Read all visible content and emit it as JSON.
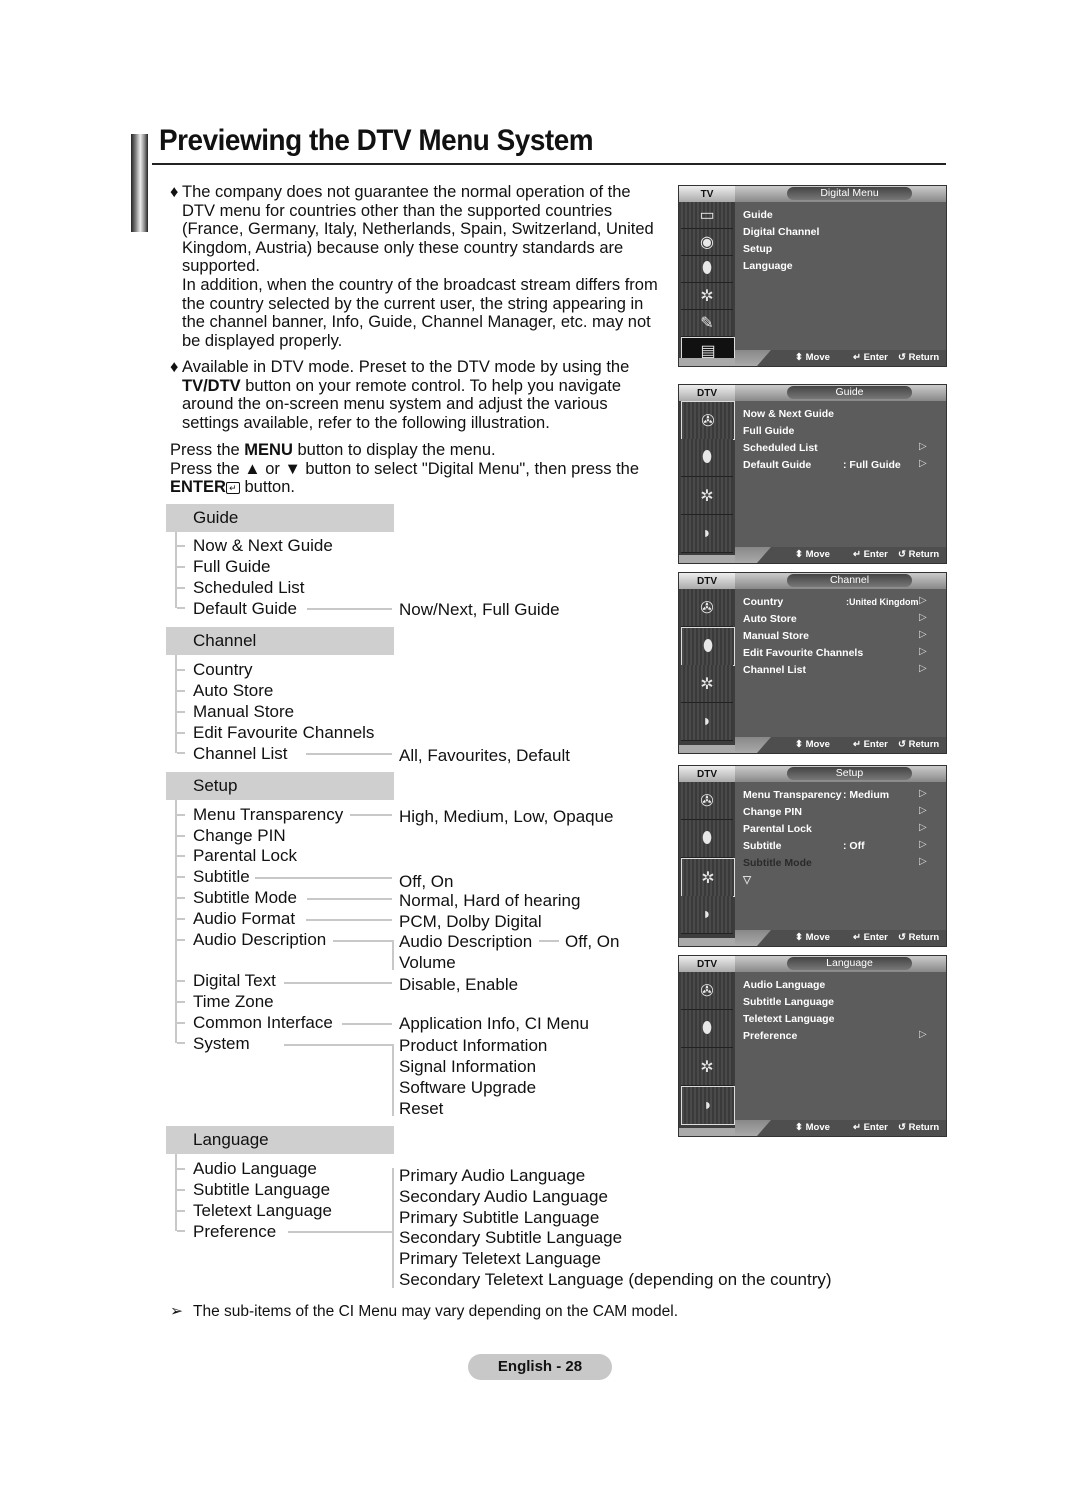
{
  "title": "Previewing the DTV Menu System",
  "bullets": [
    {
      "icon": "♦",
      "lines": [
        "The company does not guarantee the normal operation of the",
        "DTV menu for countries other than the supported countries",
        "(France, Germany, Italy, Netherlands, Spain, Switzerland, United",
        "Kingdom, Austria) because only these country standards are",
        "supported.",
        "In addition, when the country of the broadcast stream differs from",
        "the country selected by the current user, the string appearing in",
        "the channel banner, Info, Guide, Channel Manager, etc. may not",
        "be displayed properly."
      ]
    },
    {
      "icon": "♦",
      "lines_prefix": "Available in DTV mode. Preset to the DTV mode by using the",
      "bold_word": "TV/DTV",
      "line2_rest": " button on your remote control. To help you navigate",
      "line3": "around the on-screen menu system and adjust the various",
      "line4": "settings available, refer to the following illustration."
    }
  ],
  "instructions": {
    "l1_pre": "Press the ",
    "l1_bold": "MENU",
    "l1_post": " button to display the menu.",
    "l2": "Press the ▲ or ▼ button to select \"Digital Menu\", then press the",
    "l3_bold": "ENTER",
    "l3_post": " button."
  },
  "tree": {
    "guide": {
      "heading": "Guide",
      "items": [
        "Now & Next Guide",
        "Full Guide",
        "Scheduled List",
        "Default Guide"
      ],
      "options": {
        "default_guide": "Now/Next, Full Guide"
      }
    },
    "channel": {
      "heading": "Channel",
      "items": [
        "Country",
        "Auto Store",
        "Manual Store",
        "Edit Favourite Channels",
        "Channel List"
      ],
      "options": {
        "channel_list": "All, Favourites, Default"
      }
    },
    "setup": {
      "heading": "Setup",
      "items": [
        "Menu Transparency",
        "Change PIN",
        "Parental Lock",
        "Subtitle",
        "Subtitle Mode",
        "Audio Format",
        "Audio Description",
        "Digital Text",
        "Time Zone",
        "Common Interface",
        "System"
      ],
      "options": {
        "menu_transparency": "High, Medium, Low, Opaque",
        "subtitle": "Off, On",
        "subtitle_mode": "Normal, Hard of hearing",
        "audio_format": "PCM, Dolby Digital",
        "audio_description": [
          "Audio Description",
          "Volume"
        ],
        "audio_description_sub": "Off, On",
        "digital_text": "Disable, Enable",
        "common_interface": "Application Info, CI Menu",
        "system": [
          "Product Information",
          "Signal Information",
          "Software Upgrade",
          "Reset"
        ]
      }
    },
    "language": {
      "heading": "Language",
      "items": [
        "Audio Language",
        "Subtitle Language",
        "Teletext Language",
        "Preference"
      ],
      "options": {
        "preference": [
          "Primary Audio Language",
          "Secondary Audio Language",
          "Primary Subtitle Language",
          "Secondary Subtitle Language",
          "Primary Teletext Language",
          "Secondary Teletext Language (depending on the country)"
        ]
      }
    }
  },
  "panels": [
    {
      "mode": "TV",
      "title": "Digital Menu",
      "items": [
        {
          "label": "Guide"
        },
        {
          "label": "Digital Channel"
        },
        {
          "label": "Setup"
        },
        {
          "label": "Language"
        }
      ]
    },
    {
      "mode": "DTV",
      "title": "Guide",
      "items": [
        {
          "label": "Now & Next Guide"
        },
        {
          "label": "Full Guide"
        },
        {
          "label": "Scheduled List",
          "arrow": true
        },
        {
          "label": "Default Guide",
          "value": ": Full Guide",
          "arrow": true
        }
      ]
    },
    {
      "mode": "DTV",
      "title": "Channel",
      "items": [
        {
          "label": "Country",
          "value": ":United Kingdom",
          "arrow": true
        },
        {
          "label": "Auto Store",
          "arrow": true
        },
        {
          "label": "Manual Store",
          "arrow": true
        },
        {
          "label": "Edit Favourite Channels",
          "arrow": true
        },
        {
          "label": "Channel List",
          "arrow": true
        }
      ]
    },
    {
      "mode": "DTV",
      "title": "Setup",
      "items": [
        {
          "label": "Menu Transparency",
          "value": ": Medium",
          "arrow": true
        },
        {
          "label": "Change PIN",
          "arrow": true
        },
        {
          "label": "Parental Lock",
          "arrow": true
        },
        {
          "label": "Subtitle",
          "value": ": Off",
          "arrow": true
        },
        {
          "label": "Subtitle  Mode",
          "arrow": true,
          "dim": true
        }
      ],
      "more": "▽"
    },
    {
      "mode": "DTV",
      "title": "Language",
      "items": [
        {
          "label": "Audio Language"
        },
        {
          "label": "Subtitle Language"
        },
        {
          "label": "Teletext Language"
        },
        {
          "label": "Preference",
          "arrow": true
        }
      ]
    }
  ],
  "panel_footer": {
    "move": "Move",
    "enter": "Enter",
    "return": "Return"
  },
  "note": {
    "icon": "➢",
    "text": "The sub-items of the CI Menu may vary depending on the CAM model."
  },
  "page_label": "English - 28"
}
